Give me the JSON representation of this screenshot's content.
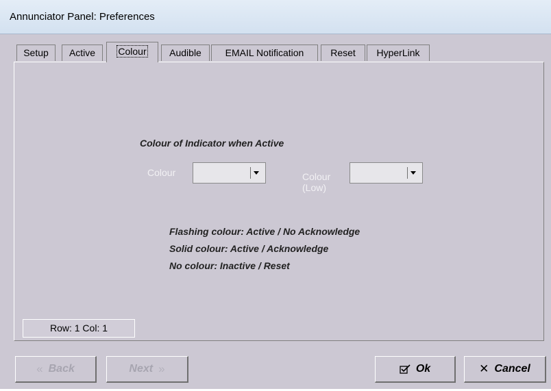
{
  "window": {
    "title": "Annunciator Panel: Preferences"
  },
  "tabs": [
    {
      "label": "Setup"
    },
    {
      "label": "Active"
    },
    {
      "label": "Colour",
      "selected": true
    },
    {
      "label": "Audible"
    },
    {
      "label": "EMAIL Notification"
    },
    {
      "label": "Reset"
    },
    {
      "label": "HyperLink"
    }
  ],
  "colour_panel": {
    "heading": "Colour of Indicator when Active",
    "colour_label": "Colour",
    "colour_value": "",
    "colour_low_label_1": "Colour",
    "colour_low_label_2": "(Low)",
    "colour_low_value": "",
    "info": [
      "Flashing colour: Active / No Acknowledge",
      "Solid colour: Active / Acknowledge",
      "No colour: Inactive / Reset"
    ]
  },
  "status": {
    "row_col": "Row: 1  Col: 1"
  },
  "buttons": {
    "back": "Back",
    "next": "Next",
    "ok": "Ok",
    "cancel": "Cancel"
  },
  "icons": {
    "back": "double-chevron-left-icon",
    "next": "double-chevron-right-icon",
    "ok": "checkbox-check-icon",
    "cancel": "x-icon"
  },
  "colors": {
    "face": "#ccc8d3",
    "titlebar": "#d8e5f3",
    "disabled_text": "#a7a5b0"
  }
}
